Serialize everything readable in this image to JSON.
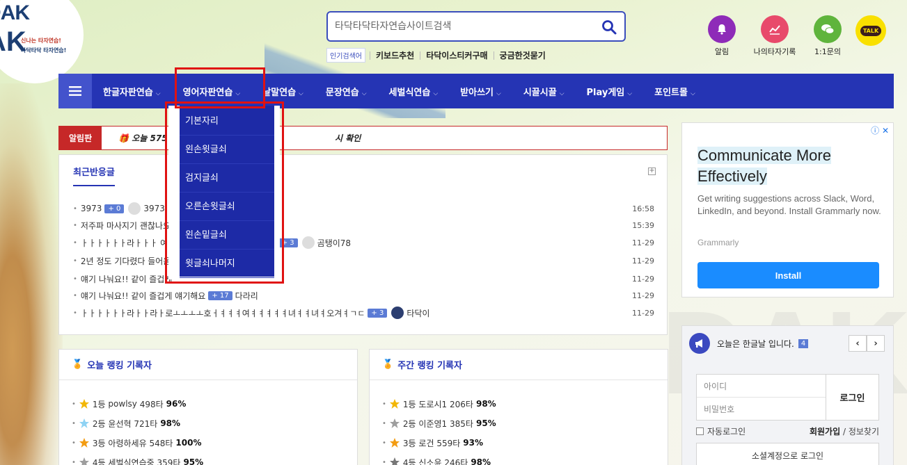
{
  "logo": {
    "line1": "DAK",
    "line2": "AK",
    "tag1": "신나는 타자연습!",
    "tag2": "타닥타닥 타자연습!"
  },
  "search": {
    "placeholder": "타닥타닥타자연습사이트검색"
  },
  "popular": {
    "tag": "인기검색어",
    "keywords": [
      "키보드추천",
      "타닥이스티커구매",
      "궁금한것묻기"
    ]
  },
  "top_icons": [
    {
      "label": "알림",
      "icon": "bell-icon",
      "color": "#8e2bb8"
    },
    {
      "label": "나의타자기록",
      "icon": "chart-icon",
      "color": "#e84a6b"
    },
    {
      "label": "1:1문의",
      "icon": "chat-icon",
      "color": "#5fb43c"
    }
  ],
  "talk": {
    "label": "TALK",
    "color": "#f9e000"
  },
  "nav": {
    "items": [
      "한글자판연습",
      "영어자판연습",
      "낱말연습",
      "문장연습",
      "세벌식연습",
      "받아쓰기",
      "시끌시끌",
      "Play게임",
      "포인트몰"
    ],
    "active_index": 1
  },
  "dropdown": {
    "items": [
      "기본자리",
      "왼손윗글쇠",
      "검지글쇠",
      "오른손윗글쇠",
      "왼손밑글쇠",
      "윗글쇠나머지"
    ]
  },
  "notice": {
    "label": "알림판",
    "text": "오늘 575출",
    "text_after": "시 확인"
  },
  "recent": {
    "title": "최근반응글",
    "rows": [
      {
        "text": "3973",
        "badge": "+ 0",
        "user": "3973",
        "date": "16:58",
        "avatar": "gray"
      },
      {
        "text": "저주파 마사지기 괜찮나요",
        "badge": "",
        "user": "",
        "date": "15:39",
        "avatar": ""
      },
      {
        "text": "ㅏㅏㅏㅏㅏㅏ라ㅏㅏㅏ                      여ㅕㅕㅕㅕ녀ㅕㅕ녀ㅕ오겨ㅕㄱㄷ",
        "badge": "+ 3",
        "user": "곰탱이78",
        "date": "11-29",
        "avatar": "gray"
      },
      {
        "text": "2년 정도 기다렸다 들어옴                                          73",
        "badge": "",
        "user": "",
        "date": "11-29",
        "avatar": ""
      },
      {
        "text": "얘기 나눠요!! 같이 즐겁게",
        "badge": "",
        "user": "",
        "date": "11-29",
        "avatar": ""
      },
      {
        "text": "얘기 나눠요!! 같이 즐겁게 얘기해요",
        "badge": "+ 17",
        "user": "다라리",
        "date": "11-29",
        "avatar": ""
      },
      {
        "text": "ㅏㅏㅏㅏㅏㅏ라ㅏㅏ라ㅏ로ㅗㅗㅗㅗ호ㅓㅕㅕㅕ여ㅕㅕㅕㅕㅕ녀ㅕㅕ녀ㅕ오겨ㅕㄱㄷ",
        "badge": "+ 3",
        "user": "타닥이",
        "date": "11-29",
        "avatar": "dark"
      }
    ]
  },
  "today_rank": {
    "title": "오늘 랭킹 기록자",
    "rows": [
      {
        "rank": "1등",
        "name": "powlsy",
        "speed": "498타",
        "acc": "96%",
        "medal": "#f2b705"
      },
      {
        "rank": "2등",
        "name": "윤선혁",
        "speed": "721타",
        "acc": "98%",
        "medal": "#8fd3f4"
      },
      {
        "rank": "3등",
        "name": "아령하세유",
        "speed": "548타",
        "acc": "100%",
        "medal": "#f39c12"
      },
      {
        "rank": "4등",
        "name": "세벌식연습중",
        "speed": "359타",
        "acc": "95%",
        "medal": "#9e9e9e"
      }
    ]
  },
  "week_rank": {
    "title": "주간 랭킹 기록자",
    "rows": [
      {
        "rank": "1등",
        "name": "도로시1",
        "speed": "206타",
        "acc": "98%",
        "medal": "#f2b705"
      },
      {
        "rank": "2등",
        "name": "이준영1",
        "speed": "385타",
        "acc": "95%",
        "medal": "#9e9e9e"
      },
      {
        "rank": "3등",
        "name": "로건",
        "speed": "559타",
        "acc": "93%",
        "medal": "#f39c12"
      },
      {
        "rank": "4등",
        "name": "신소윤",
        "speed": "246타",
        "acc": "98%",
        "medal": "#777777"
      }
    ]
  },
  "ad": {
    "headline1": "Communicate More",
    "headline2": "Effectively",
    "body": "Get writing suggestions across Slack, Word, LinkedIn, and beyond. Install Grammarly now.",
    "brand": "Grammarly",
    "button": "Install",
    "info": "ⓘ ✕"
  },
  "side": {
    "today_text": "오늘은 한글날 입니다.",
    "today_count": "4",
    "prev": "‹",
    "next": "›",
    "id_placeholder": "아이디",
    "pw_placeholder": "비밀번호",
    "login": "로그인",
    "auto_login": "자동로그인",
    "join": "회원가입",
    "sep": "/",
    "find": "정보찾기",
    "social": "소셜계정으로 로그인"
  }
}
